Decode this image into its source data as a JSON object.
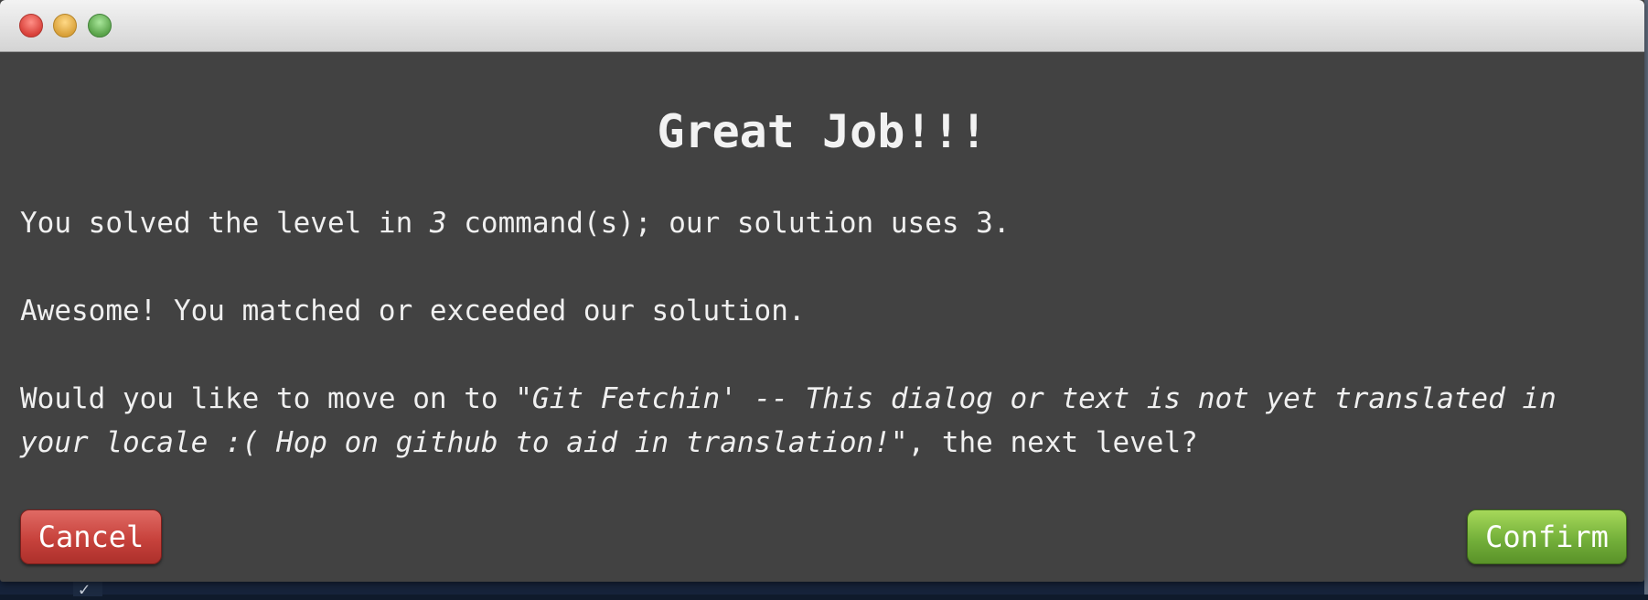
{
  "dialog": {
    "title": "Great Job!!!",
    "paragraph1": {
      "prefix": "You solved the level in ",
      "user_count": "3",
      "suffix": " command(s); our solution uses 3."
    },
    "paragraph2": "Awesome! You matched or exceeded our solution.",
    "paragraph3": {
      "prefix": "Would you like to move on to \"",
      "level_name": "Git Fetchin' -- This dialog or text is not yet translated in your locale :( Hop on github to aid in translation!",
      "suffix": "\", the next level?"
    },
    "cancel_label": "Cancel",
    "confirm_label": "Confirm"
  },
  "colors": {
    "dialog_background": "#424242",
    "cancel_button": "#c7423c",
    "confirm_button": "#74b03a"
  },
  "icons": {
    "window_controls": [
      "close-icon",
      "minimize-icon",
      "zoom-icon"
    ],
    "background_peek": "checkbox-icon"
  }
}
